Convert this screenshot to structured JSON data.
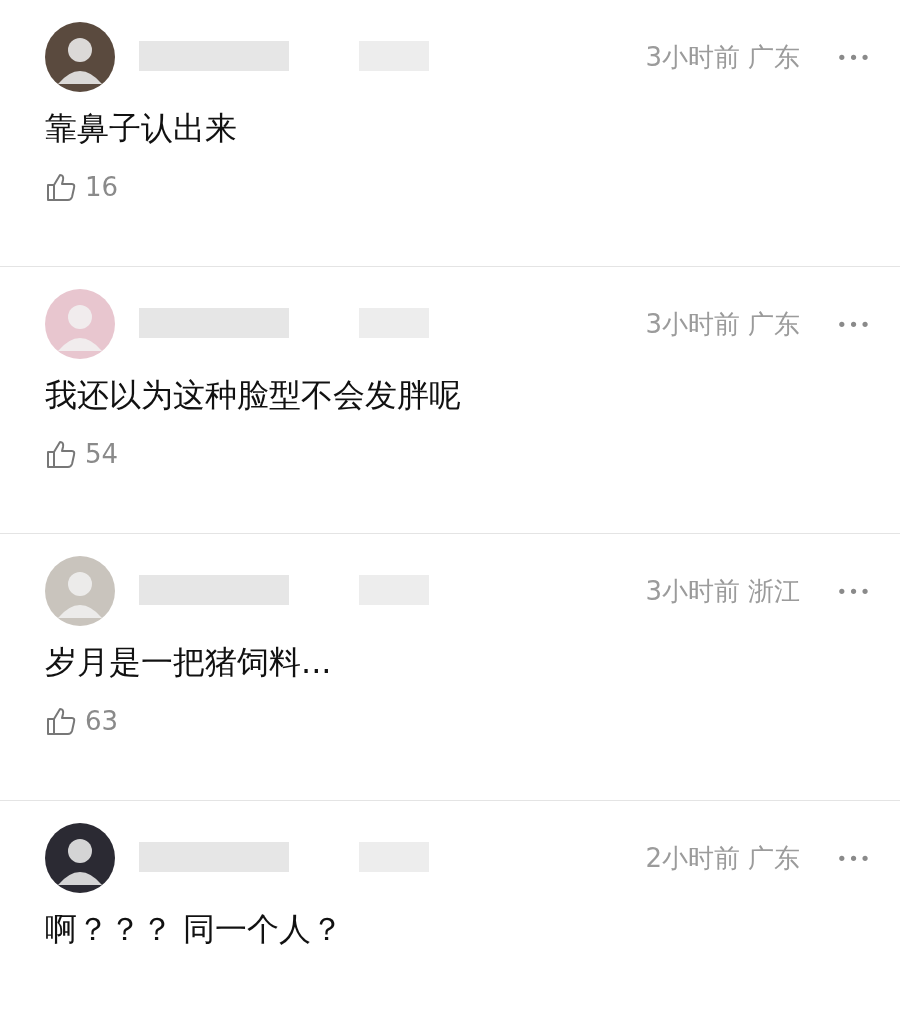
{
  "comments": [
    {
      "time": "3小时前",
      "location": "广东",
      "more": "•••",
      "text": "靠鼻子认出来",
      "likes": "16",
      "color": "#5a4a3e"
    },
    {
      "time": "3小时前",
      "location": "广东",
      "more": "•••",
      "text": "我还以为这种脸型不会发胖呢",
      "likes": "54",
      "color": "#e8c6cf"
    },
    {
      "time": "3小时前",
      "location": "浙江",
      "more": "•••",
      "text": "岁月是一把猪饲料...",
      "likes": "63",
      "color": "#c9c4bd"
    },
    {
      "time": "2小时前",
      "location": "广东",
      "more": "•••",
      "text": "啊？？？ 同一个人？",
      "color": "#2b2a33"
    }
  ]
}
